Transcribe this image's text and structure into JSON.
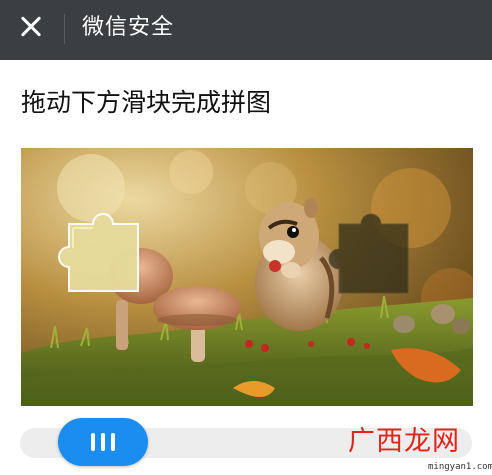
{
  "header": {
    "title": "微信安全",
    "close_icon": "close-icon"
  },
  "instruction": "拖动下方滑块完成拼图",
  "captcha": {
    "image_description_icon": "chipmunk-photo",
    "slider_icon": "three-bar-grip-icon",
    "slider_color": "#1b8cf0"
  },
  "watermark": {
    "name": "广西龙网",
    "url": "mingyan1.com"
  }
}
